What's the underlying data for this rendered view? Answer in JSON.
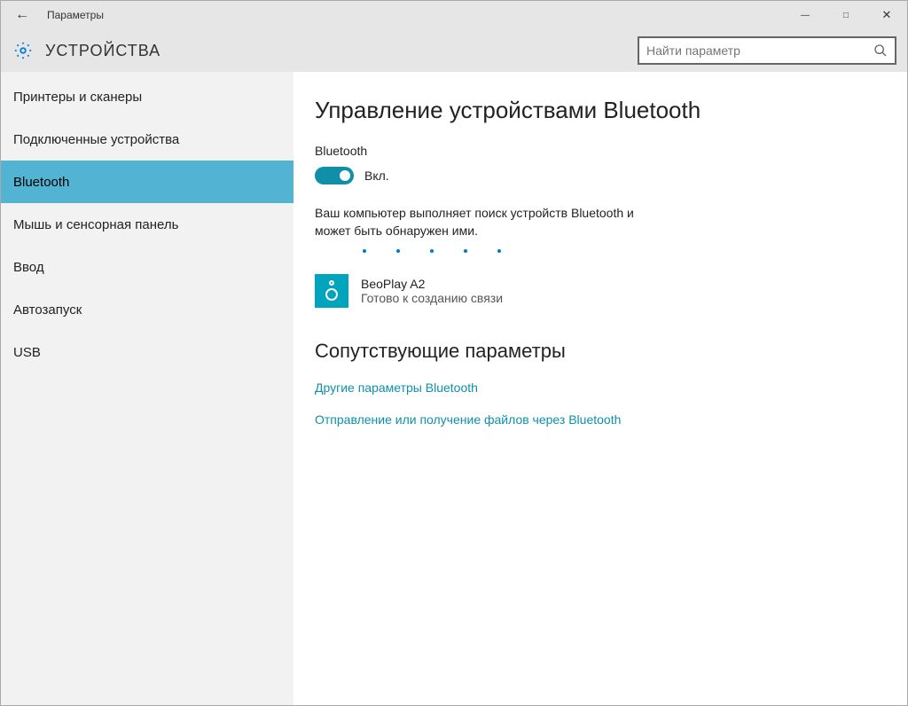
{
  "window": {
    "title": "Параметры"
  },
  "header": {
    "title": "УСТРОЙСТВА",
    "search_placeholder": "Найти параметр"
  },
  "sidebar": {
    "items": [
      {
        "label": "Принтеры и сканеры"
      },
      {
        "label": "Подключенные устройства"
      },
      {
        "label": "Bluetooth"
      },
      {
        "label": "Мышь и сенсорная панель"
      },
      {
        "label": "Ввод"
      },
      {
        "label": "Автозапуск"
      },
      {
        "label": "USB"
      }
    ]
  },
  "main": {
    "page_title": "Управление устройствами Bluetooth",
    "toggle_section_label": "Bluetooth",
    "toggle_state_label": "Вкл.",
    "status_text": "Ваш компьютер выполняет поиск устройств Bluetooth и может быть обнаружен ими.",
    "device": {
      "name": "BeoPlay A2",
      "status": "Готово к созданию связи"
    },
    "related_title": "Сопутствующие параметры",
    "links": [
      "Другие параметры Bluetooth",
      "Отправление или получение файлов через Bluetooth"
    ]
  }
}
